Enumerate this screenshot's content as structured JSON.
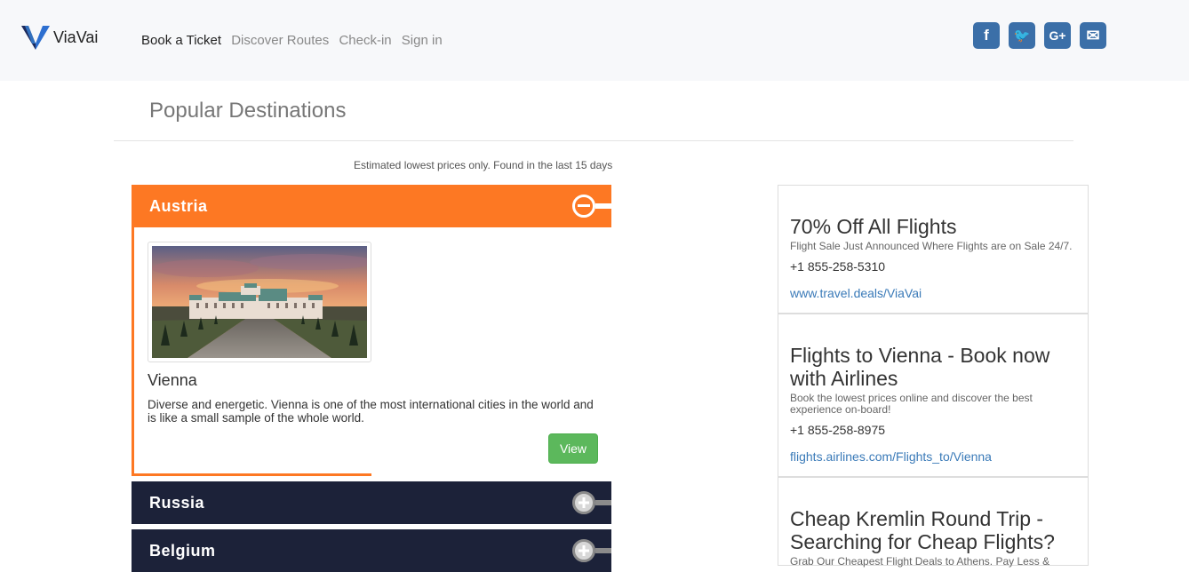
{
  "header": {
    "brand": "ViaVai",
    "nav": [
      "Book a Ticket",
      "Discover Routes",
      "Check-in",
      "Sign in"
    ],
    "social_icons": [
      "facebook-icon",
      "twitter-icon",
      "google-plus-icon",
      "envelope-icon"
    ],
    "social_glyphs": [
      "f",
      "🐦",
      "G+",
      "✉"
    ],
    "social_color": "#3b6fa8"
  },
  "page": {
    "title": "Popular Destinations",
    "note": "Estimated lowest prices only. Found in the last 15 days"
  },
  "accordion": [
    {
      "country": "Austria",
      "expanded": true,
      "color": "#fd7823",
      "toggle_symbol": "−",
      "destination": {
        "city": "Vienna",
        "description": "Diverse and energetic. Vienna is one of the most international cities in the world and is like a small sample of the whole world.",
        "button": "View"
      }
    },
    {
      "country": "Russia",
      "expanded": false,
      "color": "#1c2239",
      "toggle_symbol": "+"
    },
    {
      "country": "Belgium",
      "expanded": false,
      "color": "#1c2239",
      "toggle_symbol": "+"
    }
  ],
  "ads": [
    {
      "title": "70% Off All Flights",
      "subtitle": "Flight Sale Just Announced Where Flights are on Sale 24/7.",
      "phone": "+1 855-258-5310",
      "url": "www.travel.deals/ViaVai"
    },
    {
      "title": "Flights to Vienna - Book now with Airlines",
      "subtitle": "Book the lowest prices online and discover the best experience on-board!",
      "phone": "+1 855-258-8975",
      "url": "flights.airlines.com/Flights_to/Vienna"
    },
    {
      "title": "Cheap Kremlin Round Trip - Searching for Cheap Flights?",
      "subtitle": "Grab Our Cheapest Flight Deals to Athens. Pay Less &"
    }
  ]
}
